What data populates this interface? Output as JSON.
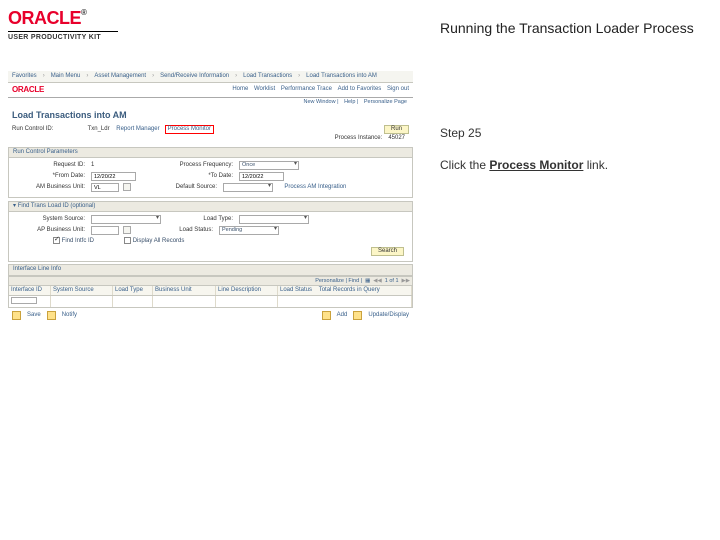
{
  "branding": {
    "product_mark": "ORACLE",
    "reg_mark": "®",
    "product_subtitle": "USER PRODUCTIVITY KIT"
  },
  "doc": {
    "title": "Running the Transaction Loader Process",
    "step_label": "Step 25",
    "instruction_prefix": "Click the ",
    "instruction_link": "Process Monitor",
    "instruction_suffix": " link."
  },
  "ss": {
    "breadcrumb": [
      "Favorites",
      "Main Menu",
      "Asset Management",
      "Send/Receive Information",
      "Load Transactions",
      "Load Transactions into AM"
    ],
    "mini_links": [
      "Home",
      "Worklist",
      "Performance Trace",
      "Add to Favorites",
      "Sign out"
    ],
    "newwin_links": [
      "New Window",
      "Help",
      "Personalize Page"
    ],
    "page_title": "Load Transactions into AM",
    "run_control": {
      "label": "Run Control ID:",
      "value": "Txn_Ldr",
      "report_mgr": "Report Manager",
      "process_monitor": "Process Monitor",
      "run_btn": "Run",
      "sched_lbl": "Process Instance:",
      "sched_val": "45027"
    },
    "panel1": {
      "title": "Run Control Parameters",
      "fields": {
        "request_id_lbl": "Request ID:",
        "request_id_val": "1",
        "process_freq_lbl": "Process Frequency:",
        "process_freq_val": "Once",
        "from_date_lbl": "*From Date:",
        "from_date_val": "12/20/22",
        "to_date_lbl": "*To Date:",
        "to_date_val": "12/20/22",
        "am_bu_lbl": "AM Business Unit:",
        "am_bu_val": "VL",
        "def_prof_lbl": "Default Source:",
        "pm_link": "Process AM Integration"
      }
    },
    "panel2": {
      "title": "Find Trans Load ID (optional)",
      "fields": {
        "sys_src_lbl": "System Source:",
        "load_type_lbl": "Load Type:",
        "ap_bu_lbl": "AP Business Unit:",
        "load_status_lbl": "Load Status:",
        "load_status_val": "Pending",
        "find_intfc_chk": "Find Intfc ID",
        "edit_FA_chk": "Display All Records",
        "search_btn": "Search"
      }
    },
    "grid": {
      "title": "Interface Line Info",
      "ctrl_text": "Personalize | Find |",
      "range": "1 of 1",
      "cols": [
        "Interface ID",
        "System Source",
        "Load Type",
        "Business Unit",
        "Line Description",
        "Load Status"
      ],
      "last_col_note": "Total Records in Query",
      "row": [
        "",
        "",
        "",
        "",
        "",
        ""
      ]
    },
    "footer": {
      "save": "Save",
      "notify": "Notify",
      "add": "Add",
      "update": "Update/Display"
    }
  }
}
